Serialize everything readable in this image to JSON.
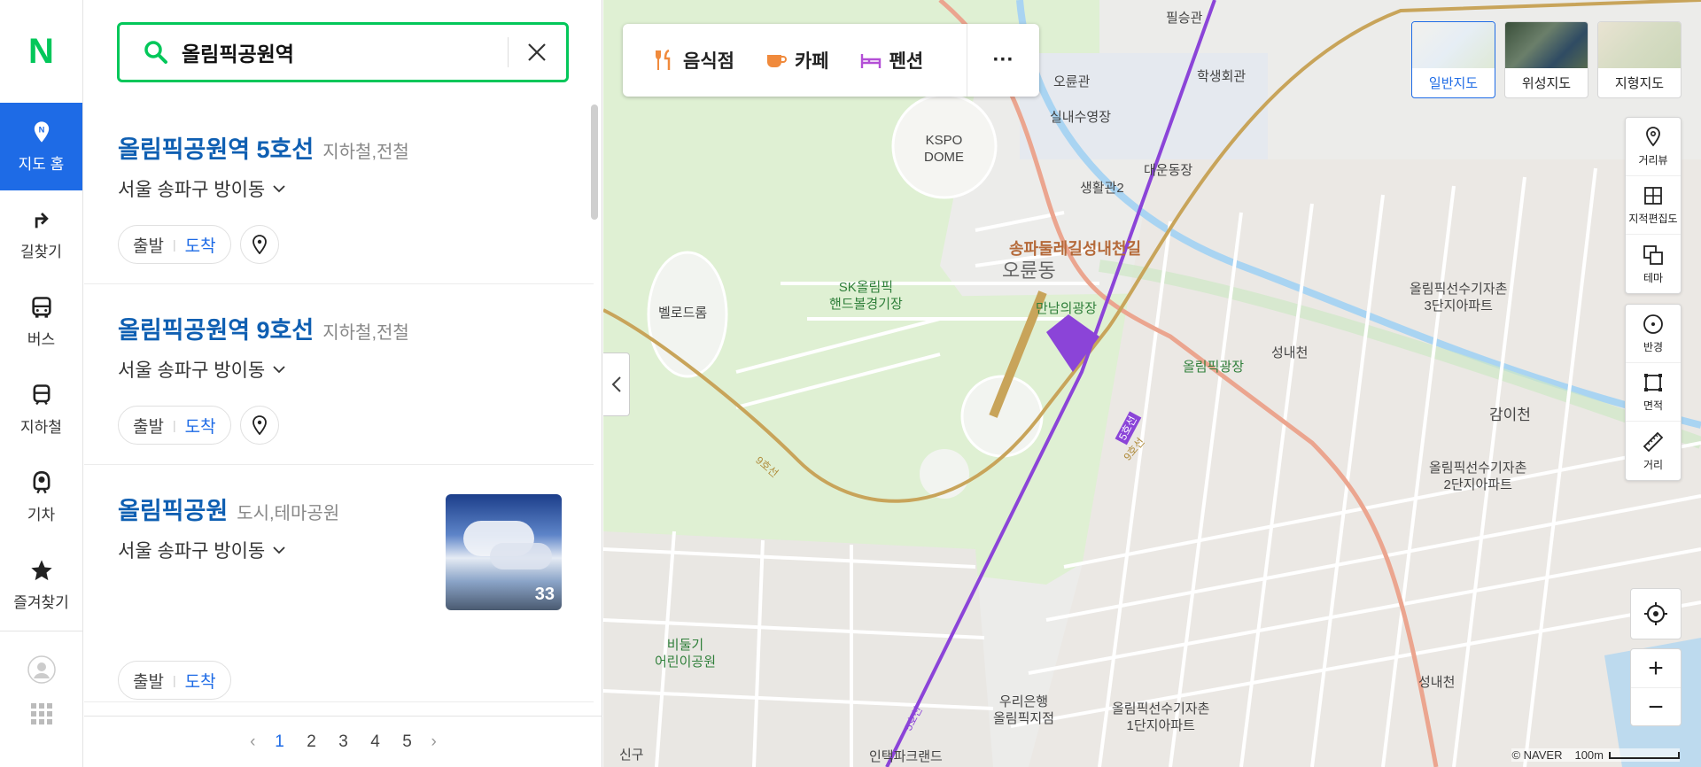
{
  "nav": {
    "logo": "N",
    "items": [
      {
        "label": "지도 홈",
        "icon": "map-home-icon"
      },
      {
        "label": "길찾기",
        "icon": "directions-icon"
      },
      {
        "label": "버스",
        "icon": "bus-icon"
      },
      {
        "label": "지하철",
        "icon": "subway-icon"
      },
      {
        "label": "기차",
        "icon": "train-icon"
      },
      {
        "label": "즐겨찾기",
        "icon": "star-icon"
      }
    ]
  },
  "search": {
    "query": "올림픽공원역"
  },
  "results": [
    {
      "name": "올림픽공원역 5호선",
      "category": "지하철,전철",
      "address": "서울 송파구 방이동",
      "start": "출발",
      "end": "도착"
    },
    {
      "name": "올림픽공원역 9호선",
      "category": "지하철,전철",
      "address": "서울 송파구 방이동",
      "start": "출발",
      "end": "도착"
    },
    {
      "name": "올림픽공원",
      "category": "도시,테마공원",
      "address": "서울 송파구 방이동",
      "start": "출발",
      "end": "도착",
      "photo_count": "33"
    }
  ],
  "pagination": {
    "pages": [
      "1",
      "2",
      "3",
      "4",
      "5"
    ],
    "current": "1"
  },
  "map": {
    "categories": [
      {
        "label": "음식점",
        "icon": "restaurant-icon",
        "color": "#f08a3c"
      },
      {
        "label": "카페",
        "icon": "cafe-icon",
        "color": "#f08a3c"
      },
      {
        "label": "펜션",
        "icon": "pension-icon",
        "color": "#b34fd6"
      }
    ],
    "more_label": "···",
    "map_types": [
      {
        "label": "일반지도",
        "active": true
      },
      {
        "label": "위성지도",
        "active": false
      },
      {
        "label": "지형지도",
        "active": false
      }
    ],
    "tools_top": [
      {
        "label": "거리뷰",
        "icon": "street-view-icon"
      },
      {
        "label": "지적편집도",
        "icon": "cadastral-icon"
      },
      {
        "label": "테마",
        "icon": "theme-icon"
      }
    ],
    "tools_bottom": [
      {
        "label": "반경",
        "icon": "radius-icon"
      },
      {
        "label": "면적",
        "icon": "area-icon"
      },
      {
        "label": "거리",
        "icon": "ruler-icon"
      }
    ],
    "zoom_in": "+",
    "zoom_out": "−",
    "copyright": "© NAVER",
    "scale": "100m",
    "labels": {
      "pilseung": "필승관",
      "orungwan": "오륜관",
      "student": "학생회관",
      "indoor_pool": "실내수영장",
      "daeun": "대운동장",
      "dorm2": "생활관2",
      "kspo": "KSPO\nDOME",
      "road_name": "송파둘레길성내천길",
      "orun_dong": "오륜동",
      "velodrome": "벨로드롬",
      "sk_handball": "SK올림픽\n핸드볼경기장",
      "mannam": "만남의광장",
      "olympic_plaza": "올림픽광장",
      "seongnae_cheon": "성내천",
      "apt3": "올림픽선수기자촌\n3단지아파트",
      "gamicheon": "감이천",
      "apt2": "올림픽선수기자촌\n2단지아파트",
      "line9": "9호선",
      "line5": "5호선",
      "bidulgi_park": "비둘기\n어린이공원",
      "woori_bank": "우리은행\n올림픽지점",
      "apt1": "올림픽선수기자촌\n1단지아파트",
      "seongnae_cheon2": "성내천",
      "singu": "신구",
      "intake": "인택파크랜드"
    }
  }
}
